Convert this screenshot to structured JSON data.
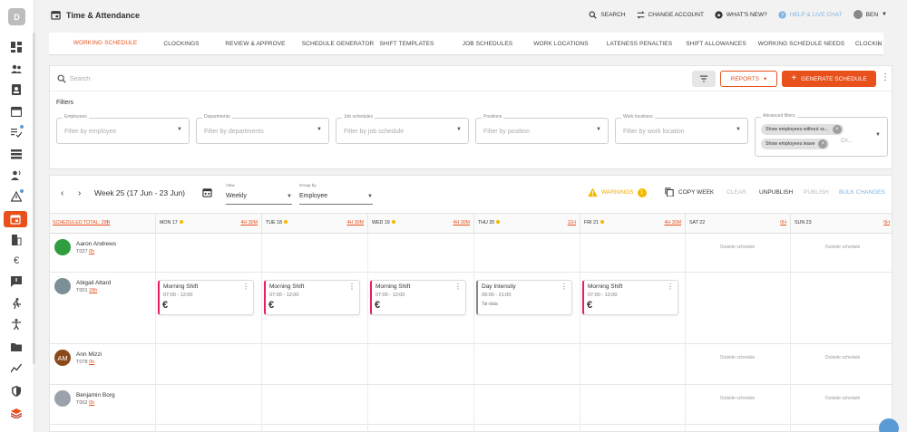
{
  "app": {
    "logo_letter": "D",
    "title": "Time & Attendance"
  },
  "header": {
    "search": "SEARCH",
    "change_account": "CHANGE ACCOUNT",
    "whats_new": "WHAT'S NEW?",
    "help": "HELP & LIVE CHAT",
    "user": "BEN"
  },
  "tabs": [
    "WORKING SCHEDULE",
    "CLOCKINGS",
    "REVIEW & APPROVE",
    "SCHEDULE GENERATOR",
    "SHIFT TEMPLATES",
    "JOB SCHEDULES",
    "WORK LOCATIONS",
    "LATENESS PENALTIES",
    "SHIFT ALLOWANCES",
    "WORKING SCHEDULE NEEDS",
    "CLOCKIN"
  ],
  "toolbar": {
    "search_placeholder": "Search",
    "reports": "REPORTS",
    "generate": "GENERATE SCHEDULE"
  },
  "filters": {
    "title": "Filters",
    "fields": [
      {
        "label": "Employees",
        "placeholder": "Filter by employee"
      },
      {
        "label": "Departments",
        "placeholder": "Filter by departments"
      },
      {
        "label": "Job schedules",
        "placeholder": "Filter by job schedule"
      },
      {
        "label": "Positions",
        "placeholder": "Filter by position"
      },
      {
        "label": "Work locations",
        "placeholder": "Filter by work location"
      }
    ],
    "advanced": {
      "label": "Advanced filters",
      "chips": [
        "Show employees without sc...",
        "Show employees leave"
      ],
      "more": "Ch..."
    }
  },
  "week": {
    "label": "Week 25 (17 Jun - 23 Jun)",
    "view_label": "View",
    "view_value": "Weekly",
    "group_label": "Group by",
    "group_value": "Employee",
    "warnings": "WARNINGS",
    "warnings_count": "1",
    "copy_week": "COPY WEEK",
    "clear": "CLEAR",
    "unpublish": "UNPUBLISH",
    "publish": "PUBLISH",
    "bulk_changes": "BULK CHANGES"
  },
  "grid": {
    "scheduled_total": "SCHEDULED TOTAL: 29H",
    "days": [
      {
        "day": "MON 17",
        "hours": "4H 30M",
        "dot": true
      },
      {
        "day": "TUE 18",
        "hours": "4H 30M",
        "dot": true
      },
      {
        "day": "WED 19",
        "hours": "4H 30M",
        "dot": true
      },
      {
        "day": "THU 20",
        "hours": "11H",
        "dot": true
      },
      {
        "day": "FRI 21",
        "hours": "4H 30M",
        "dot": true
      },
      {
        "day": "SAT 22",
        "hours": "0H",
        "dot": false
      },
      {
        "day": "SUN 23",
        "hours": "0H",
        "dot": false
      }
    ],
    "outside_text": "Outside schedule",
    "employees": [
      {
        "name": "Aaron Andrews",
        "id": "T027",
        "hours": "0h",
        "initials": "",
        "avatar_color": "#2e9e3e"
      },
      {
        "name": "Abigail Attard",
        "id": "T001",
        "hours": "29h",
        "initials": "",
        "avatar_color": "#7a8f96"
      },
      {
        "name": "Ann Mizzi",
        "id": "T078",
        "hours": "0h",
        "initials": "AM",
        "avatar_color": "#8a4a1a"
      },
      {
        "name": "Benjamin Borg",
        "id": "T002",
        "hours": "0h",
        "initials": "",
        "avatar_color": "#9aa3ab"
      }
    ],
    "shifts": [
      {
        "day": 0,
        "name": "Morning Shift",
        "time": "07:00 - 12:00",
        "euro": "€"
      },
      {
        "day": 1,
        "name": "Morning Shift",
        "time": "07:00 - 12:00",
        "euro": "€"
      },
      {
        "day": 2,
        "name": "Morning Shift",
        "time": "07:00 - 12:00",
        "euro": "€"
      },
      {
        "day": 3,
        "name": "Day Intensity",
        "time": "09:00 - 21:00",
        "note": "Tal-data"
      },
      {
        "day": 4,
        "name": "Morning Shift",
        "time": "07:00 - 12:00",
        "euro": "€"
      }
    ]
  },
  "colors": {
    "accent": "#e8501c",
    "link": "#5b9bd5",
    "warning": "#f5b800",
    "shift_border": "#e91e63"
  }
}
